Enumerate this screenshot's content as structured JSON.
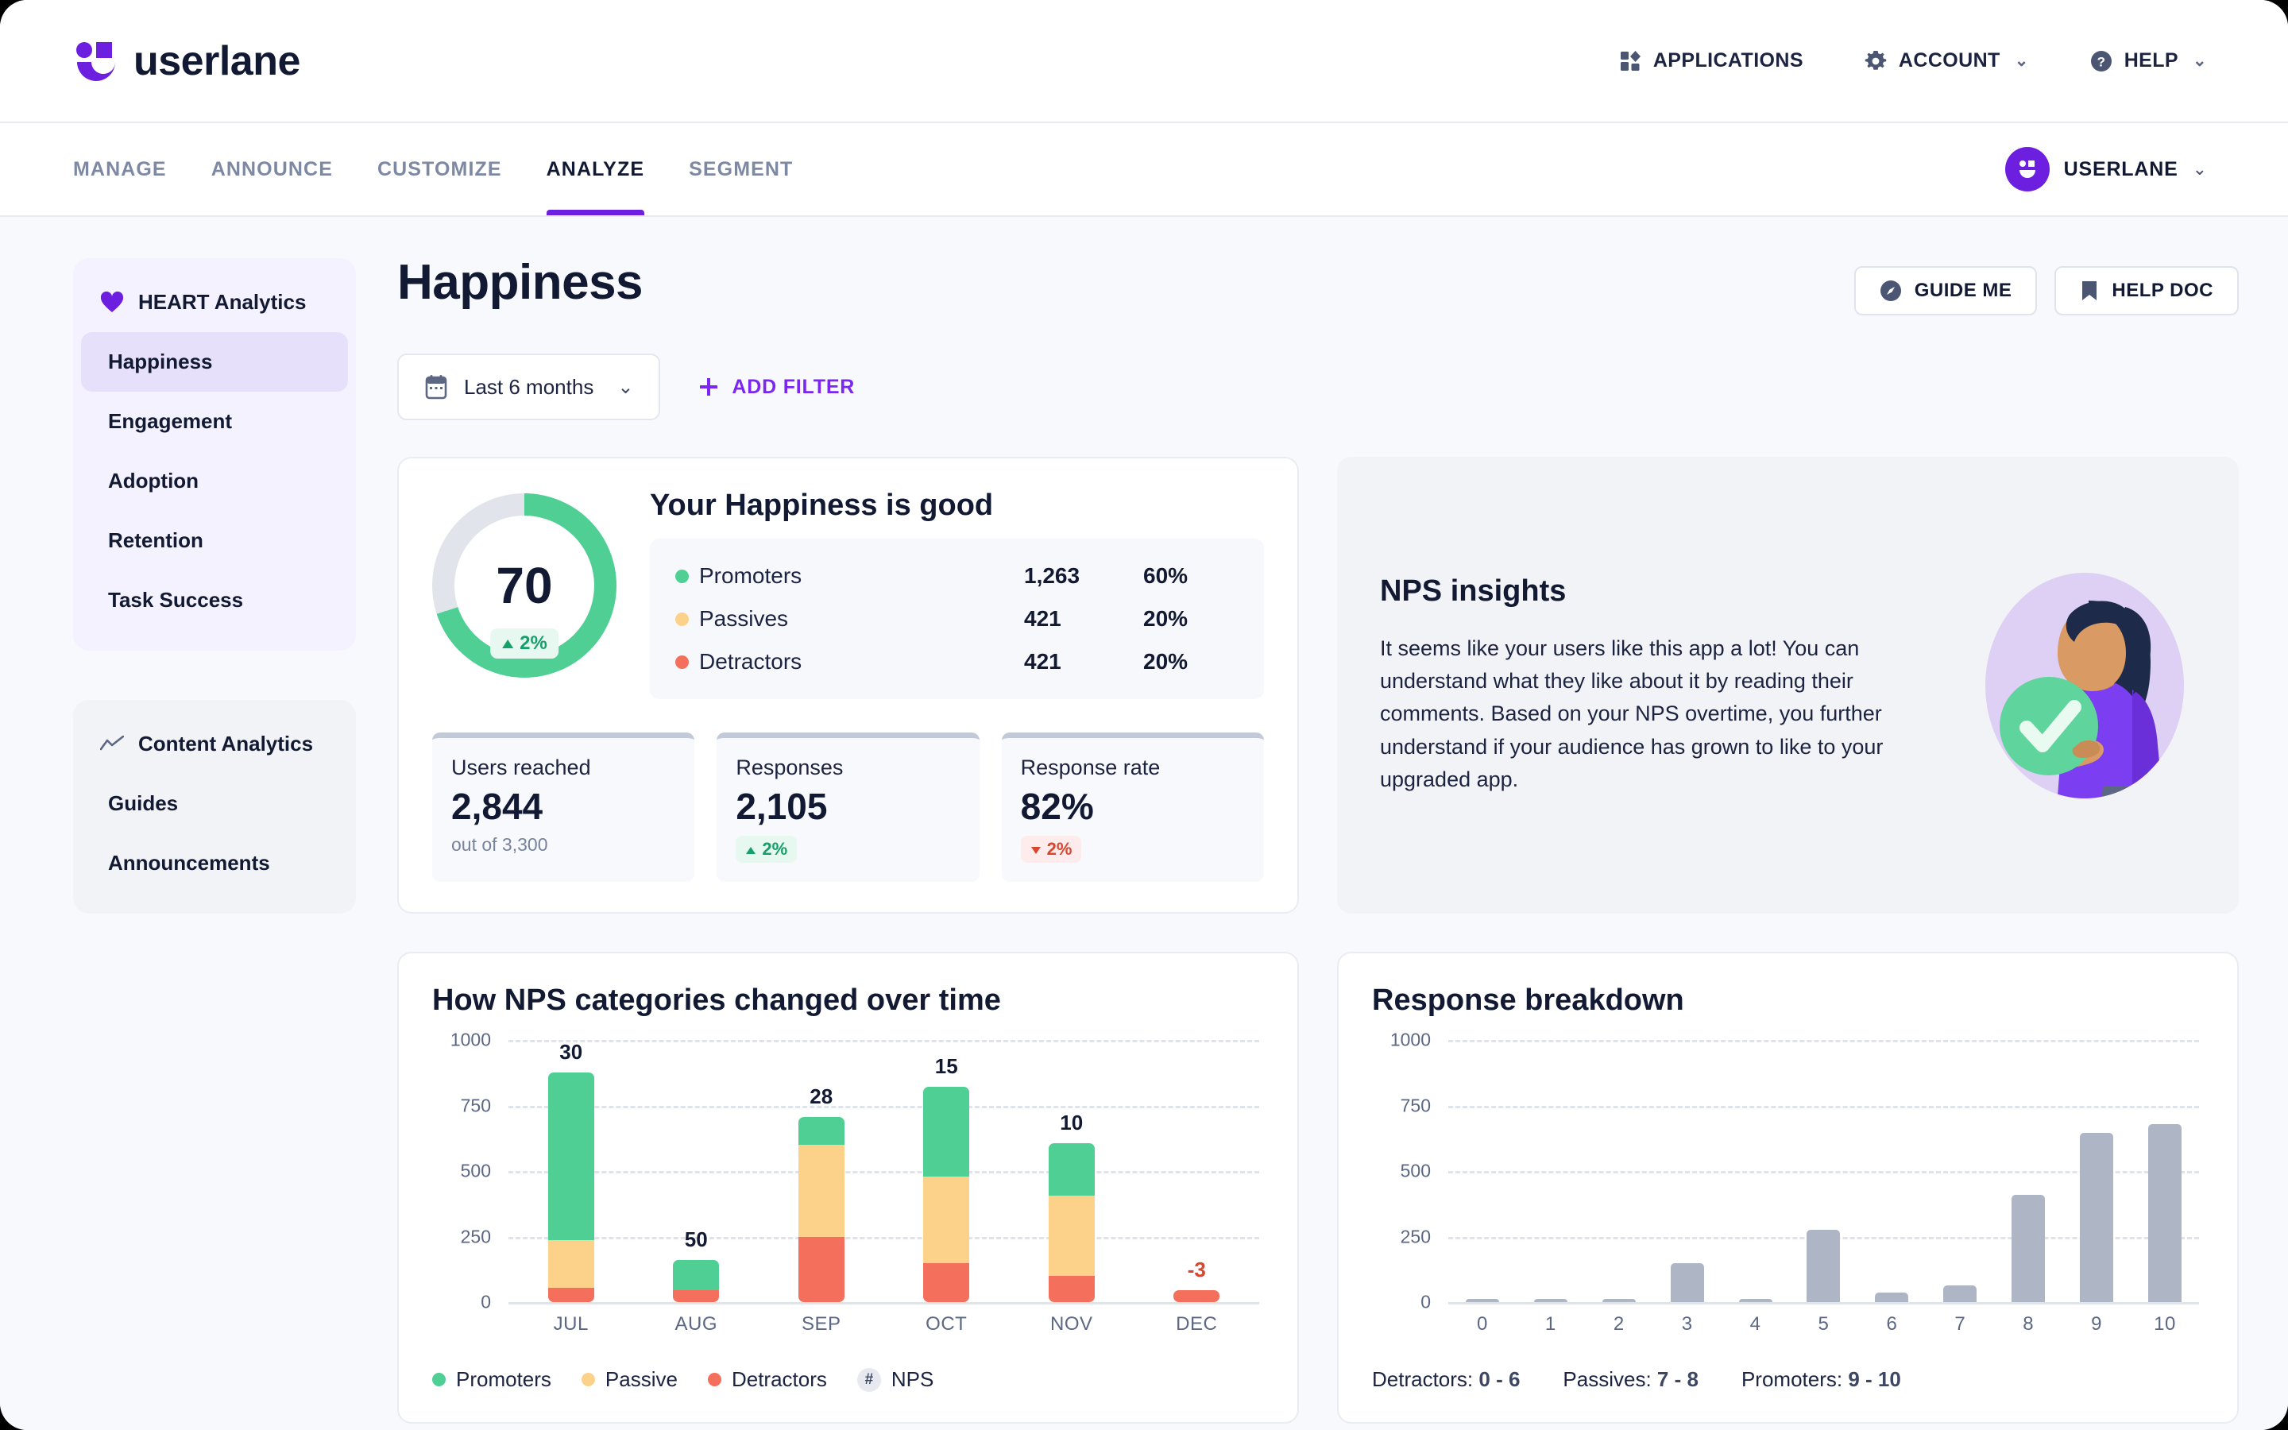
{
  "brand": {
    "name": "userlane",
    "accent": "#6d1fe0"
  },
  "topnav": [
    {
      "label": "APPLICATIONS",
      "icon": "apps-icon",
      "chevron": ""
    },
    {
      "label": "ACCOUNT",
      "icon": "gear-icon",
      "chevron": "⌄"
    },
    {
      "label": "HELP",
      "icon": "question-circle-icon",
      "chevron": "⌄"
    }
  ],
  "tabs": [
    {
      "label": "MANAGE",
      "active": false
    },
    {
      "label": "ANNOUNCE",
      "active": false
    },
    {
      "label": "CUSTOMIZE",
      "active": false
    },
    {
      "label": "ANALYZE",
      "active": true
    },
    {
      "label": "SEGMENT",
      "active": false
    }
  ],
  "account": {
    "name": "USERLANE",
    "chevron": "⌄"
  },
  "sidebar": {
    "heart": {
      "title": "HEART Analytics",
      "icon": "heart-icon",
      "items": [
        {
          "label": "Happiness",
          "active": true
        },
        {
          "label": "Engagement",
          "active": false
        },
        {
          "label": "Adoption",
          "active": false
        },
        {
          "label": "Retention",
          "active": false
        },
        {
          "label": "Task Success",
          "active": false
        }
      ]
    },
    "content": {
      "title": "Content Analytics",
      "icon": "line-chart-icon",
      "items": [
        {
          "label": "Guides",
          "active": false
        },
        {
          "label": "Announcements",
          "active": false
        }
      ]
    }
  },
  "page": {
    "title": "Happiness",
    "buttons": [
      {
        "label": "GUIDE ME",
        "icon": "compass-icon"
      },
      {
        "label": "HELP DOC",
        "icon": "bookmark-icon"
      }
    ]
  },
  "filters": {
    "date_range": "Last 6 months",
    "date_icon": "calendar-icon",
    "date_chevron": "⌄",
    "add_filter": "ADD FILTER",
    "add_filter_icon": "plus-icon"
  },
  "nps_summary": {
    "score": "70",
    "score_delta": "2%",
    "score_delta_dir": "up",
    "title": "Your Happiness is good",
    "rows": [
      {
        "label": "Promoters",
        "count": "1,263",
        "percent": "60%",
        "color": "#4fcf93"
      },
      {
        "label": "Passives",
        "count": "421",
        "percent": "20%",
        "color": "#fcd28a"
      },
      {
        "label": "Detractors",
        "count": "421",
        "percent": "20%",
        "color": "#f5705c"
      }
    ],
    "kpis": [
      {
        "label": "Users reached",
        "value": "2,844",
        "sub": "out of 3,300",
        "pill": "",
        "pill_dir": ""
      },
      {
        "label": "Responses",
        "value": "2,105",
        "sub": "",
        "pill": "2%",
        "pill_dir": "up"
      },
      {
        "label": "Response rate",
        "value": "82%",
        "sub": "",
        "pill": "2%",
        "pill_dir": "down"
      }
    ]
  },
  "insights": {
    "title": "NPS insights",
    "body": "It seems like your users like this app a lot! You can understand what they like about it by reading their comments. Based on your NPS overtime, you further understand if your audience has grown to like to your upgraded app.",
    "illustration": "person-with-checkmark-illustration"
  },
  "charts": {
    "left_title": "How NPS categories changed over time",
    "right_title": "Response breakdown",
    "left_legend": [
      {
        "label": "Promoters",
        "color": "#4fcf93",
        "marker": "dot"
      },
      {
        "label": "Passive",
        "color": "#fcd28a",
        "marker": "dot"
      },
      {
        "label": "Detractors",
        "color": "#f5705c",
        "marker": "dot"
      },
      {
        "label": "NPS",
        "color": "#e6e9ef",
        "marker": "hash"
      }
    ],
    "right_legend": [
      {
        "label": "Detractors:",
        "range": "0 - 6"
      },
      {
        "label": "Passives:",
        "range": "7 - 8"
      },
      {
        "label": "Promoters:",
        "range": "9 - 10"
      }
    ]
  },
  "chart_data": [
    {
      "type": "bar",
      "id": "nps-categories-over-time",
      "title": "How NPS categories changed over time",
      "stacked": true,
      "categories": [
        "JUL",
        "AUG",
        "SEP",
        "OCT",
        "NOV",
        "DEC"
      ],
      "series": [
        {
          "name": "Detractors",
          "color": "#f5705c",
          "values": [
            55,
            45,
            250,
            150,
            100,
            45
          ]
        },
        {
          "name": "Passive",
          "color": "#fcd28a",
          "values": [
            180,
            0,
            350,
            330,
            305,
            0
          ]
        },
        {
          "name": "Promoters",
          "color": "#4fcf93",
          "values": [
            640,
            115,
            105,
            340,
            200,
            0
          ]
        }
      ],
      "point_labels": [
        "30",
        "50",
        "28",
        "15",
        "10",
        "-3"
      ],
      "point_label_colors": [
        "#121a33",
        "#121a33",
        "#121a33",
        "#121a33",
        "#121a33",
        "#d9452f"
      ],
      "ylabel": "",
      "xlabel": "",
      "ylim": [
        0,
        1000
      ],
      "yticks": [
        0,
        250,
        500,
        750,
        1000
      ],
      "grid": true,
      "legend": "bottom-left"
    },
    {
      "type": "bar",
      "id": "response-breakdown",
      "title": "Response breakdown",
      "stacked": false,
      "categories": [
        "0",
        "1",
        "2",
        "3",
        "4",
        "5",
        "6",
        "7",
        "8",
        "9",
        "10"
      ],
      "values": [
        3,
        3,
        4,
        150,
        5,
        275,
        35,
        65,
        410,
        645,
        680
      ],
      "color": "#aeb6c6",
      "ylabel": "",
      "xlabel": "",
      "ylim": [
        0,
        1000
      ],
      "yticks": [
        0,
        250,
        500,
        750,
        1000
      ],
      "grid": true,
      "legend": "bottom-left"
    }
  ]
}
